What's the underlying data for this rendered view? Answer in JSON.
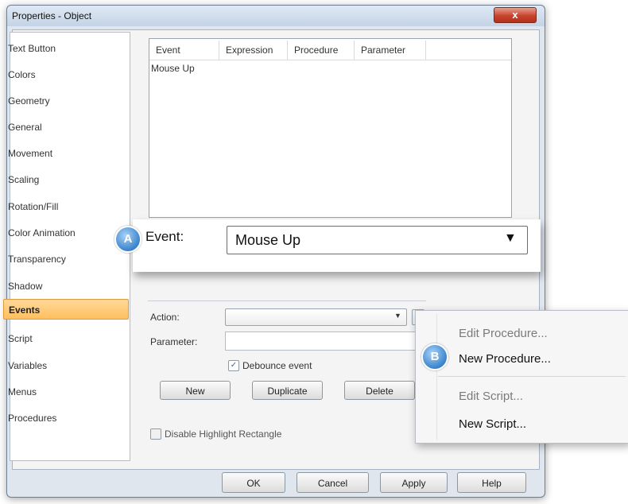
{
  "window": {
    "title": "Properties - Object",
    "close_glyph": "x"
  },
  "nav": {
    "items": [
      "Text Button",
      "Colors",
      "Geometry",
      "General",
      "Movement",
      "Scaling",
      "Rotation/Fill",
      "Color Animation",
      "Transparency",
      "Shadow",
      "Events",
      "Script",
      "Variables",
      "Menus",
      "Procedures"
    ],
    "selected": "Events"
  },
  "table": {
    "columns": [
      "Event",
      "Expression",
      "Procedure",
      "Parameter"
    ],
    "rows": [
      [
        "Mouse Up",
        "",
        "",
        ""
      ]
    ]
  },
  "callout_a": {
    "badge": "A",
    "label": "Event:",
    "value": "Mouse Up"
  },
  "action": {
    "action_label": "Action:",
    "action_value": "",
    "parameter_label": "Parameter:",
    "parameter_value": "",
    "debounce_label": "Debounce event",
    "debounce_checked": true,
    "new_label": "New",
    "duplicate_label": "Duplicate",
    "delete_label": "Delete",
    "disable_highlight_label": "Disable Highlight Rectangle",
    "disable_highlight_checked": false
  },
  "menu": {
    "badge": "B",
    "items": [
      {
        "label": "Edit Procedure...",
        "enabled": false
      },
      {
        "label": "New Procedure...",
        "enabled": true
      },
      {
        "label": "Edit Script...",
        "enabled": false
      },
      {
        "label": "New Script...",
        "enabled": true
      }
    ]
  },
  "footer": {
    "ok": "OK",
    "cancel": "Cancel",
    "apply": "Apply",
    "help": "Help"
  },
  "colors": {
    "selected_bg": "#ffbf5e",
    "badge": "#3a84cc",
    "disabled_text": "#7a7a7a"
  },
  "icons": {
    "dropdown": "chevron-down-icon",
    "checkbox": "checkmark-icon"
  }
}
